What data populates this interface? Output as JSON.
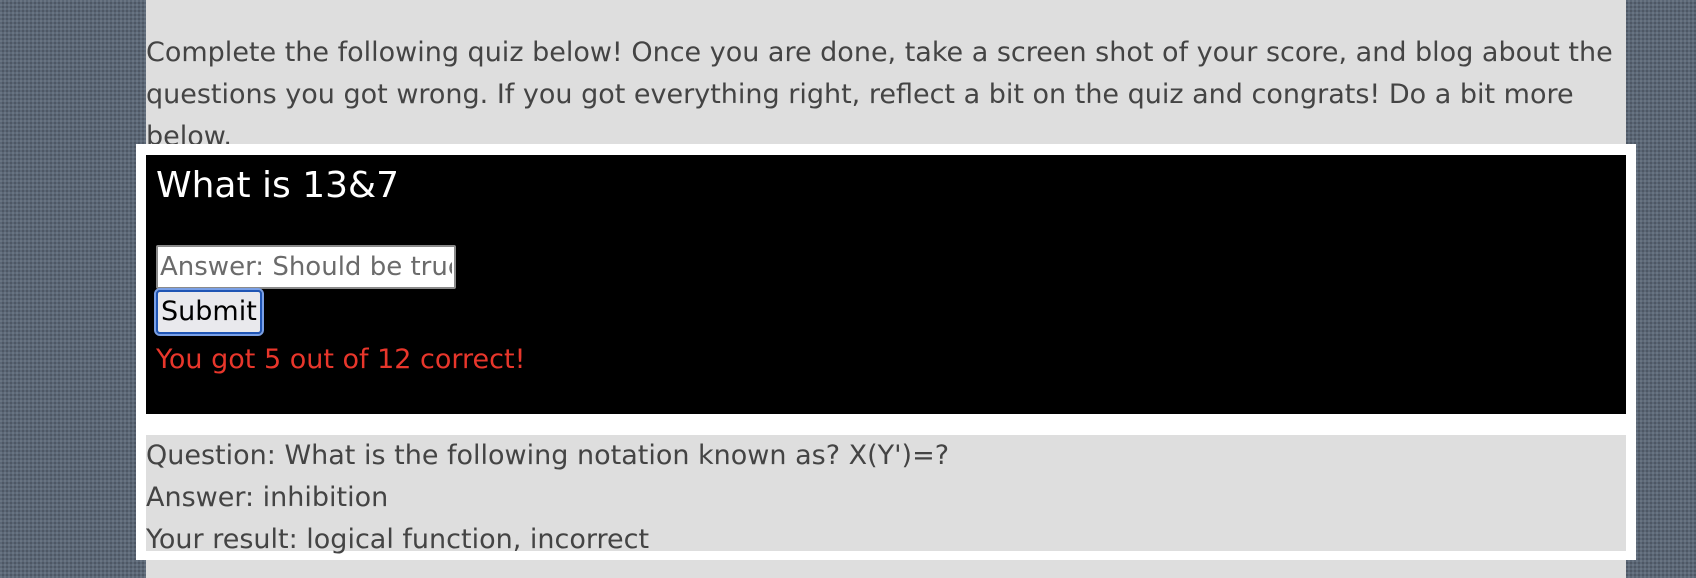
{
  "intro_text": "Complete the following quiz below! Once you are done, take a screen shot of your score, and blog about the questions you got wrong. If you got everything right, reflect a bit on the quiz and congrats! Do a bit more below.",
  "quiz": {
    "question": "What is 13&7",
    "answer_placeholder": "Answer: Should be true",
    "answer_value": "",
    "submit_label": "Submit",
    "score_text": "You got 5 out of 12 correct!"
  },
  "result": {
    "question_line": "Question: What is the following notation known as? X(Y')=?",
    "answer_line": "Answer: inhibition",
    "your_result_line": "Your result: logical function, incorrect"
  },
  "colors": {
    "page_background": "#5b6776",
    "panel_background": "#dedede",
    "quiz_background": "#000000",
    "score_text": "#e8362b",
    "focus_ring": "#1f55b5"
  }
}
